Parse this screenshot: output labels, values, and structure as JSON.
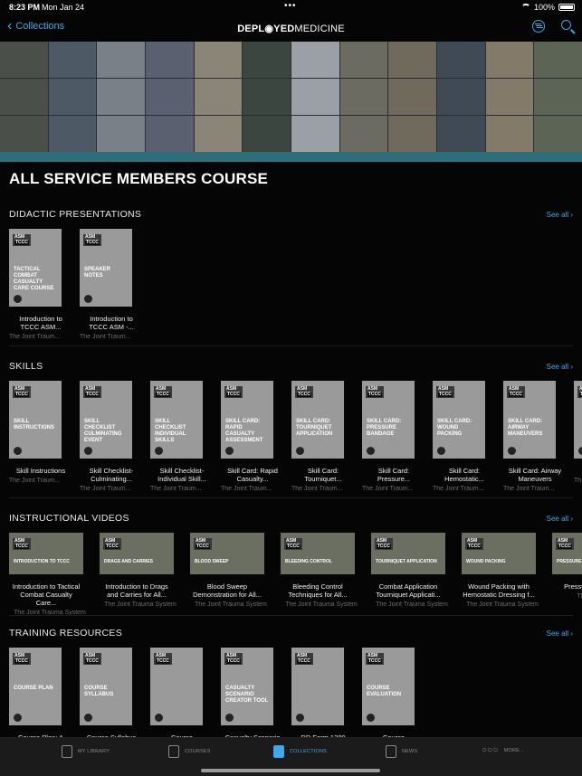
{
  "status_bar": {
    "time": "8:23 PM",
    "date": "Mon Jan 24",
    "battery": "100%"
  },
  "nav": {
    "back_label": "Collections",
    "logo_a": "DEPL",
    "logo_b": "YED",
    "logo_c": "MEDICINE"
  },
  "course_title": "ALL SERVICE MEMBERS COURSE",
  "see_all": "See all",
  "badge": {
    "top": "ASM",
    "bottom": "TCCC"
  },
  "sections": [
    {
      "title": "DIDACTIC PRESENTATIONS",
      "items": [
        {
          "thumb": "TACTICAL COMBAT CASUALTY CARE COURSE",
          "title": "Introduction to TCCC ASM...",
          "source": "The Joint Traum..."
        },
        {
          "thumb": "SPEAKER NOTES",
          "title": "Introduction to TCCC ASM -...",
          "source": "The Joint Traum..."
        }
      ]
    },
    {
      "title": "SKILLS",
      "items": [
        {
          "thumb": "SKILL INSTRUCTIONS",
          "title": "Skill Instructions",
          "source": "The Joint Traum..."
        },
        {
          "thumb": "SKILL CHECKLIST CULMINATING EVENT",
          "title": "Skill Checklist-Culminating...",
          "source": "The Joint Traum..."
        },
        {
          "thumb": "SKILL CHECKLIST INDIVIDUAL SKILLS",
          "title": "Skill Checklist-Individual Skill...",
          "source": "The Joint Traum..."
        },
        {
          "thumb": "SKILL CARD: RAPID CASUALTY ASSESSMENT",
          "title": "Skill Card: Rapid Casualty...",
          "source": "The Joint Traum..."
        },
        {
          "thumb": "SKILL CARD: TOURNIQUET APPLICATION",
          "title": "Skill Card: Tourniquet...",
          "source": "The Joint Traum..."
        },
        {
          "thumb": "SKILL CARD: PRESSURE BANDAGE",
          "title": "Skill Card: Pressure...",
          "source": "The Joint Traum..."
        },
        {
          "thumb": "SKILL CARD: WOUND PACKING",
          "title": "Skill Card: Hemostatic...",
          "source": "The Joint Traum..."
        },
        {
          "thumb": "SKILL CARD: AIRWAY MANEUVERS",
          "title": "Skill Card: Airway Maneuvers",
          "source": "The Joint Traum..."
        },
        {
          "thumb": "",
          "title": "Ski",
          "source": "Th"
        }
      ]
    },
    {
      "title": "INSTRUCTIONAL VIDEOS",
      "items": [
        {
          "thumb": "INTRODUCTION TO TCCC",
          "title": "Introduction to Tactical Combat Casualty Care...",
          "source": "The Joint Trauma System"
        },
        {
          "thumb": "DRAGS AND CARRIES",
          "title": "Introduction to Drags and Carries for All...",
          "source": "The Joint Trauma System"
        },
        {
          "thumb": "BLOOD SWEEP",
          "title": "Blood Sweep Demonstration for All...",
          "source": "The Joint Trauma System"
        },
        {
          "thumb": "BLEEDING CONTROL",
          "title": "Bleeding Control Techniques for All...",
          "source": "The Joint Trauma System"
        },
        {
          "thumb": "TOURNIQUET APPLICATION",
          "title": "Combat Application Tourniquet Applicati...",
          "source": "The Joint Trauma System"
        },
        {
          "thumb": "WOUND PACKING",
          "title": "Wound Packing with Hemostatic Dressing f...",
          "source": "The Joint Trauma System"
        },
        {
          "thumb": "PRESSURE BANDAGE",
          "title": "Pressur Applicati",
          "source": "The Joint T"
        }
      ]
    },
    {
      "title": "TRAINING RESOURCES",
      "items": [
        {
          "thumb": "COURSE PLAN",
          "title": "Course Plan: A",
          "source": ""
        },
        {
          "thumb": "COURSE SYLLABUS",
          "title": "Course Syllabus",
          "source": ""
        },
        {
          "thumb": "",
          "title": "Course",
          "source": ""
        },
        {
          "thumb": "CASUALTY SCENARIO CREATOR TOOL",
          "title": "Casualty Scenario",
          "source": ""
        },
        {
          "thumb": "",
          "title": "DD Form 1380",
          "source": ""
        },
        {
          "thumb": "COURSE EVALUATION",
          "title": "Course",
          "source": ""
        }
      ]
    }
  ],
  "tabs": [
    {
      "label": "MY LIBRARY"
    },
    {
      "label": "COURSES"
    },
    {
      "label": "COLLECTIONS"
    },
    {
      "label": "NEWS"
    },
    {
      "label": "MORE..."
    }
  ],
  "colors": {
    "accent": "#3ea8e8",
    "background": "#050505",
    "strip": "#2e6e7a"
  }
}
